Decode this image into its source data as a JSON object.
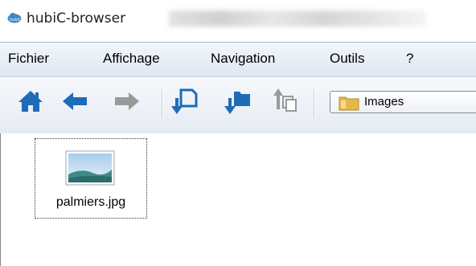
{
  "window": {
    "title": "hubiC-browser",
    "icon": "hubic-cloud-icon"
  },
  "menu": {
    "items": [
      "Fichier",
      "Affichage",
      "Navigation",
      "Outils",
      "?"
    ]
  },
  "toolbar": {
    "buttons": [
      {
        "name": "home",
        "icon": "home-icon"
      },
      {
        "name": "back",
        "icon": "arrow-left-icon"
      },
      {
        "name": "forward",
        "icon": "arrow-right-icon",
        "disabled": true
      },
      {
        "name": "download-file",
        "icon": "download-file-icon"
      },
      {
        "name": "download-folder",
        "icon": "download-folder-icon"
      },
      {
        "name": "upload",
        "icon": "upload-icon",
        "disabled": true
      }
    ],
    "path": {
      "label": "Images",
      "icon": "folder-icon"
    }
  },
  "files": [
    {
      "name": "palmiers.jpg",
      "icon": "image-file-icon"
    }
  ],
  "colors": {
    "accent": "#1e6bb8",
    "disabled": "#9a9a9a",
    "menubar": "#dde7f3"
  }
}
